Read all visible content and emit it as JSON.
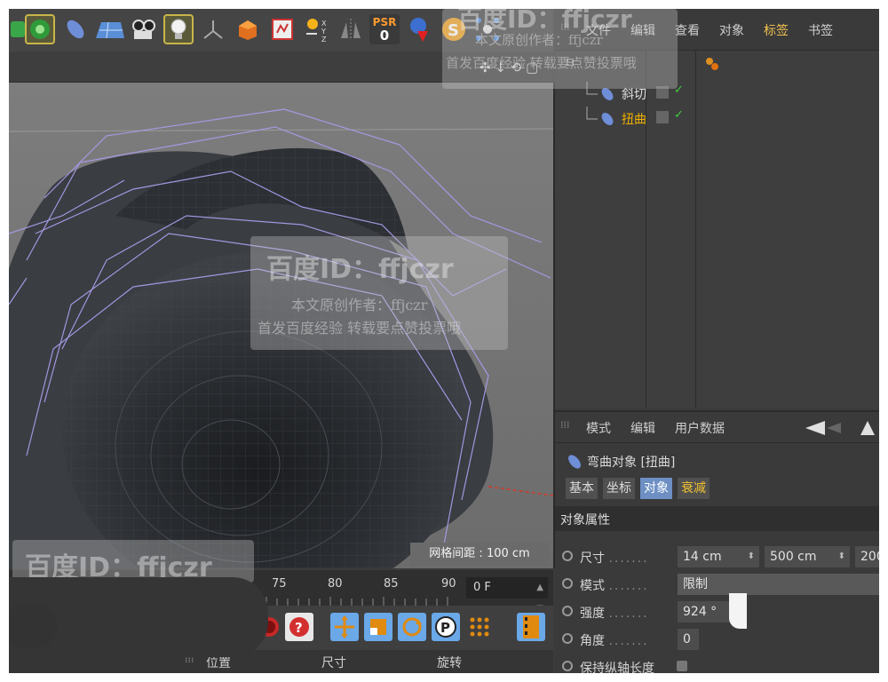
{
  "toolbar": {
    "icons": [
      "cloner-icon",
      "flower-generator-icon",
      "capsule-object-icon",
      "floor-plane-icon",
      "camera-icon",
      "light-bulb-icon",
      "null-axis-icon",
      "extrude-icon",
      "render-view-icon",
      "sun-xyz-icon",
      "symmetry-icon",
      "psr-icon",
      "deformer-arrow-icon",
      "snap-icon",
      "scatter-icon"
    ],
    "psr_label": "PSR",
    "psr_value": "0"
  },
  "object_manager": {
    "menu": [
      "文件",
      "编辑",
      "查看",
      "对象",
      "标签",
      "书签"
    ],
    "objects": [
      {
        "name": "斜切",
        "color": "#e0e0e0"
      },
      {
        "name": "扭曲",
        "color": "#f0b000"
      }
    ]
  },
  "viewport": {
    "grid_spacing": "网格间距 : 100 cm"
  },
  "timeline": {
    "ticks": [
      "75",
      "80",
      "85",
      "90"
    ],
    "current_frame": "0 F"
  },
  "coordinates": {
    "headers": [
      "位置",
      "尺寸",
      "旋转"
    ]
  },
  "attributes": {
    "menu": [
      "模式",
      "编辑",
      "用户数据"
    ],
    "title": "弯曲对象 [扭曲]",
    "tabs": [
      "基本",
      "坐标",
      "对象",
      "衰减"
    ],
    "section": "对象属性",
    "props": {
      "size_label": "尺寸",
      "size_x": "14 cm",
      "size_y": "500 cm",
      "size_z": "200",
      "mode_label": "模式",
      "mode_value": "限制",
      "strength_label": "强度",
      "strength_value": "924 °",
      "angle_label": "角度",
      "angle_value": "0",
      "keep_label": "保持纵轴长度"
    }
  },
  "watermarks": {
    "id": "百度ID：ffjczr",
    "author": "本文原创作者：ffjczr",
    "note": "首发百度经验 转载要点赞投票哦"
  }
}
